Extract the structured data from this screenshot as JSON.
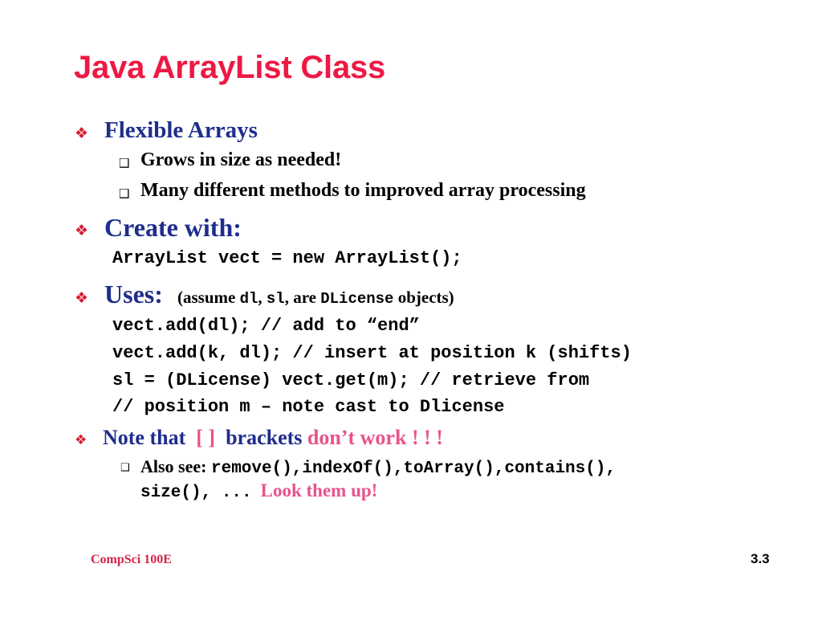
{
  "slide": {
    "title": "Java ArrayList Class",
    "colors": {
      "title": "#ED1944",
      "level1_text": "#1F2D8C",
      "bullet_marker": "#D91A33",
      "accent_pink": "#E8538C",
      "footer": "#D32348",
      "body_text": "#000000",
      "background": "#ffffff"
    },
    "bullet_glyphs": {
      "level1": "❖",
      "level2": "❑"
    },
    "content": [
      {
        "id": "flexible-arrays",
        "level": 1,
        "text": "Flexible Arrays"
      },
      {
        "id": "grows-in-size",
        "level": 2,
        "text": "Grows in size as needed!"
      },
      {
        "id": "many-methods",
        "level": 2,
        "text": "Many different methods to improved array processing"
      },
      {
        "id": "create-with",
        "level": 1,
        "text": "Create with:"
      },
      {
        "id": "code-create",
        "level": "code",
        "text": "ArrayList vect = new ArrayList();"
      },
      {
        "id": "uses",
        "level": 1,
        "text": "Uses:"
      },
      {
        "id": "uses-note-pre",
        "level": "inline",
        "text": "(assume "
      },
      {
        "id": "uses-note-dl",
        "level": "inline",
        "text": "dl"
      },
      {
        "id": "uses-note-mid1",
        "level": "inline",
        "text": ", "
      },
      {
        "id": "uses-note-sl",
        "level": "inline",
        "text": "sl"
      },
      {
        "id": "uses-note-mid2",
        "level": "inline",
        "text": ", are "
      },
      {
        "id": "uses-note-dlicense",
        "level": "inline",
        "text": "DLicense"
      },
      {
        "id": "uses-note-post",
        "level": "inline",
        "text": " objects)"
      },
      {
        "id": "code-add-end",
        "level": "code",
        "text": "vect.add(dl); // add to “end”"
      },
      {
        "id": "code-add-k",
        "level": "code",
        "text": "vect.add(k, dl); // insert at position k (shifts)"
      },
      {
        "id": "code-get",
        "level": "code",
        "text": "sl = (DLicense) vect.get(m); // retrieve from"
      },
      {
        "id": "code-comment",
        "level": "code",
        "text": "// position m – note cast to Dlicense"
      },
      {
        "id": "note-that-1",
        "level": "inline",
        "text": "Note that"
      },
      {
        "id": "note-that-brackets",
        "level": "inline",
        "text": "[  ]"
      },
      {
        "id": "note-that-2",
        "level": "inline",
        "text": "brackets"
      },
      {
        "id": "note-that-dontwork",
        "level": "inline",
        "text": "don’t work"
      },
      {
        "id": "note-that-bangs",
        "level": "inline",
        "text": "! ! !"
      },
      {
        "id": "also-see-label",
        "level": "inline",
        "text": "Also see:"
      },
      {
        "id": "also-see-methods",
        "level": "inline",
        "text": "remove(),indexOf(),toArray(),contains(),"
      },
      {
        "id": "also-see-size",
        "level": "inline",
        "text": "size(), ..."
      },
      {
        "id": "also-see-lookup",
        "level": "inline",
        "text": "Look them up!"
      }
    ],
    "footer": {
      "course": "CompSci 100E",
      "page_number": "3.3"
    }
  }
}
